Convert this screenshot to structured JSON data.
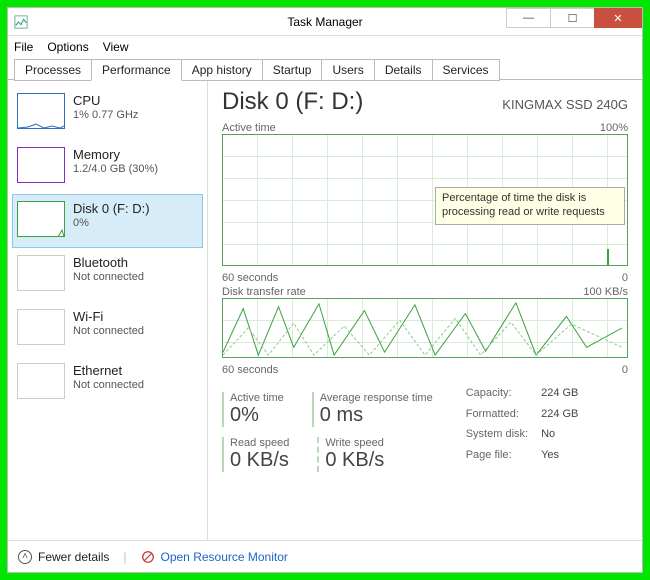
{
  "window": {
    "title": "Task Manager"
  },
  "menu": {
    "file": "File",
    "options": "Options",
    "view": "View"
  },
  "tabs": {
    "processes": "Processes",
    "performance": "Performance",
    "app_history": "App history",
    "startup": "Startup",
    "users": "Users",
    "details": "Details",
    "services": "Services"
  },
  "sidebar": {
    "cpu": {
      "title": "CPU",
      "sub": "1% 0.77 GHz"
    },
    "memory": {
      "title": "Memory",
      "sub": "1.2/4.0 GB (30%)"
    },
    "disk": {
      "title": "Disk 0 (F: D:)",
      "sub": "0%"
    },
    "bluetooth": {
      "title": "Bluetooth",
      "sub": "Not connected"
    },
    "wifi": {
      "title": "Wi-Fi",
      "sub": "Not connected"
    },
    "ethernet": {
      "title": "Ethernet",
      "sub": "Not connected"
    }
  },
  "detail": {
    "title": "Disk 0 (F: D:)",
    "model": "KINGMAX SSD 240G",
    "active_time_label": "Active time",
    "active_time_max": "100%",
    "x_left": "60 seconds",
    "x_right": "0",
    "tooltip": "Percentage of time the disk is processing read or write requests",
    "transfer_label": "Disk transfer rate",
    "transfer_max": "100 KB/s",
    "stats": {
      "active_time_label": "Active time",
      "active_time": "0%",
      "avg_resp_label": "Average response time",
      "avg_resp": "0 ms",
      "read_label": "Read speed",
      "read": "0 KB/s",
      "write_label": "Write speed",
      "write": "0 KB/s"
    },
    "props": {
      "capacity_label": "Capacity:",
      "capacity": "224 GB",
      "formatted_label": "Formatted:",
      "formatted": "224 GB",
      "sysdisk_label": "System disk:",
      "sysdisk": "No",
      "pagefile_label": "Page file:",
      "pagefile": "Yes"
    }
  },
  "footer": {
    "fewer": "Fewer details",
    "resmon": "Open Resource Monitor"
  },
  "chart_data": [
    {
      "type": "area",
      "title": "Active time",
      "xlabel": "60 seconds → 0",
      "ylabel": "Active time %",
      "ylim": [
        0,
        100
      ],
      "x_seconds_ago": [
        60,
        55,
        50,
        45,
        40,
        35,
        30,
        25,
        20,
        15,
        10,
        5,
        0
      ],
      "values_pct": [
        0,
        0,
        0,
        0,
        0,
        0,
        0,
        0,
        0,
        0,
        0,
        12,
        0
      ]
    },
    {
      "type": "area",
      "title": "Disk transfer rate",
      "xlabel": "60 seconds → 0",
      "ylabel": "KB/s",
      "ylim": [
        0,
        100
      ],
      "x_seconds_ago": [
        60,
        55,
        50,
        45,
        40,
        35,
        30,
        25,
        20,
        15,
        10,
        5,
        0
      ],
      "read_kbs": [
        10,
        60,
        5,
        70,
        15,
        80,
        20,
        65,
        30,
        55,
        90,
        40,
        20
      ],
      "write_kbs": [
        5,
        30,
        10,
        50,
        8,
        45,
        12,
        35,
        18,
        25,
        60,
        22,
        10
      ]
    }
  ]
}
